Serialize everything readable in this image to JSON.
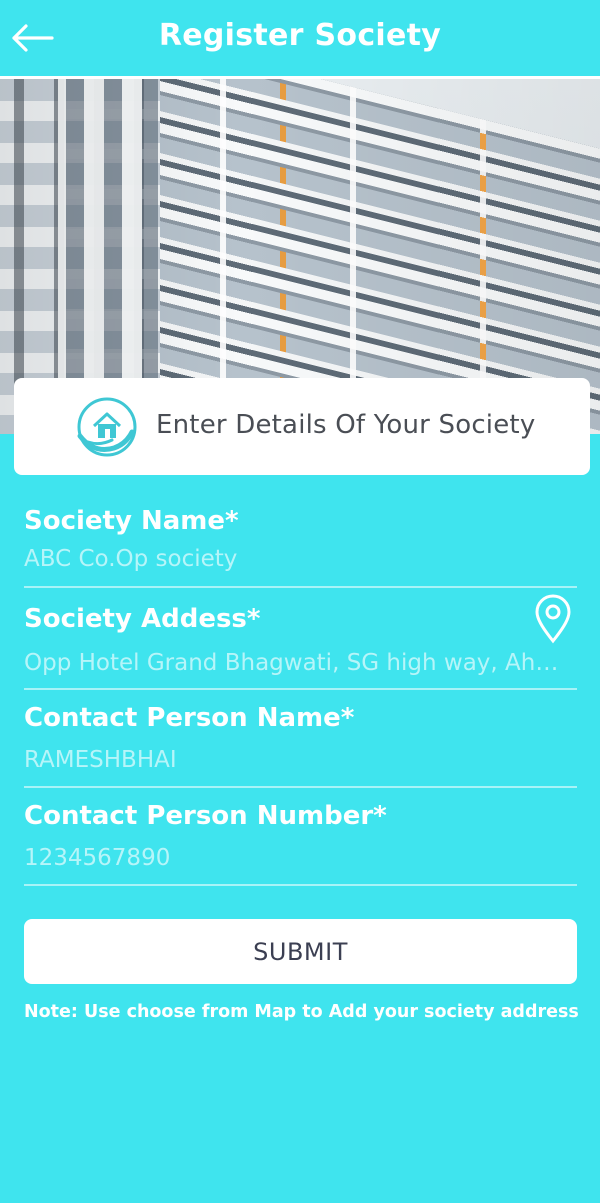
{
  "app_bar": {
    "title": "Register Society",
    "back_icon": "arrow-left-icon"
  },
  "hero": {
    "image": "apartment-building-photo"
  },
  "info_card": {
    "icon": "home-hand-icon",
    "text": "Enter Details Of Your Society"
  },
  "form": {
    "society_name": {
      "label": "Society Name*",
      "placeholder": "ABC Co.Op society"
    },
    "society_address": {
      "label": "Society Addess*",
      "placeholder": "Opp Hotel Grand Bhagwati, SG high way, Ahmedabad",
      "icon": "location-pin-icon"
    },
    "contact_person_name": {
      "label": "Contact Person Name*",
      "placeholder": "RAMESHBHAI"
    },
    "contact_person_number": {
      "label": "Contact Person Number*",
      "placeholder": "1234567890"
    }
  },
  "submit_label": "SUBMIT",
  "note": "Note: Use choose from Map to Add your society address",
  "colors": {
    "background": "#3fe4ee",
    "card": "#ffffff",
    "icon_teal": "#3fc7d4"
  }
}
